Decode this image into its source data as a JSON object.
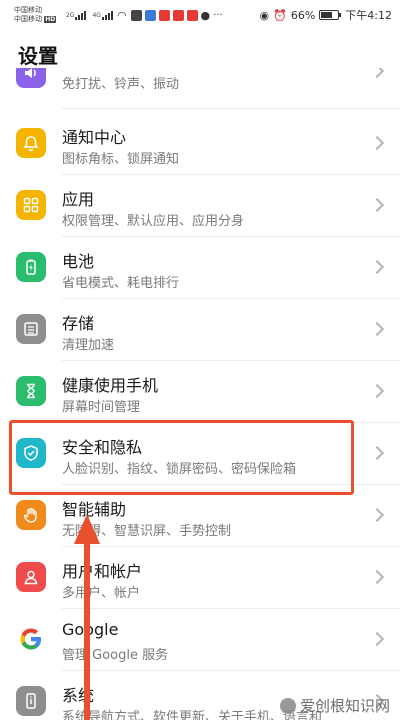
{
  "status_bar": {
    "carrier1": "中国移动",
    "carrier2": "中国移动",
    "net1": "2G",
    "net2": "4G",
    "hd_badge": "HD",
    "battery_percent": "66%",
    "battery_level": 0.66,
    "time": "下午4:12"
  },
  "header": {
    "title": "设置"
  },
  "settings": [
    {
      "id": "sound",
      "title": "",
      "subtitle": "免打扰、铃声、振动",
      "icon": "speaker-icon",
      "color": "#8a63e8"
    },
    {
      "id": "notify",
      "title": "通知中心",
      "subtitle": "图标角标、锁屏通知",
      "icon": "bell-icon",
      "color": "#f5b400"
    },
    {
      "id": "apps",
      "title": "应用",
      "subtitle": "权限管理、默认应用、应用分身",
      "icon": "grid-icon",
      "color": "#f5b400"
    },
    {
      "id": "battery",
      "title": "电池",
      "subtitle": "省电模式、耗电排行",
      "icon": "battery-icon",
      "color": "#2bbd6e"
    },
    {
      "id": "storage",
      "title": "存储",
      "subtitle": "清理加速",
      "icon": "storage-icon",
      "color": "#8e8e8e"
    },
    {
      "id": "health",
      "title": "健康使用手机",
      "subtitle": "屏幕时间管理",
      "icon": "hourglass-icon",
      "color": "#2bbd6e"
    },
    {
      "id": "privacy",
      "title": "安全和隐私",
      "subtitle": "人脸识别、指纹、锁屏密码、密码保险箱",
      "icon": "shield-icon",
      "color": "#20b8c8"
    },
    {
      "id": "assist",
      "title": "智能辅助",
      "subtitle": "无障碍、智慧识屏、手势控制",
      "icon": "hand-icon",
      "color": "#f08a1c"
    },
    {
      "id": "users",
      "title": "用户和帐户",
      "subtitle": "多用户、帐户",
      "icon": "person-icon",
      "color": "#ef4b4b"
    },
    {
      "id": "google",
      "title": "Google",
      "subtitle": "管理 Google 服务",
      "icon": "google-g-icon",
      "color": "#ffffff"
    },
    {
      "id": "system",
      "title": "系统",
      "subtitle": "系统导航方式、软件更新、关于手机、语言和",
      "icon": "phone-info-icon",
      "color": "#8e8e8e"
    }
  ],
  "watermark": {
    "text": "爱创根知识网"
  }
}
